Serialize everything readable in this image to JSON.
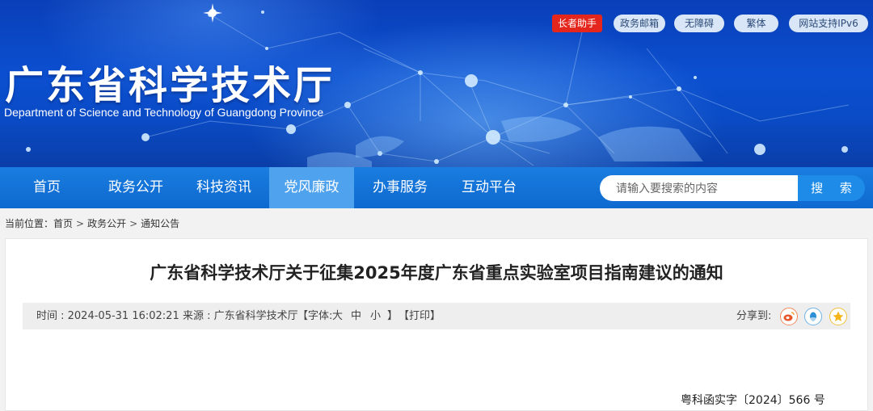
{
  "header": {
    "site_title": "广东省科学技术厅",
    "site_subtitle": "Department of Science and Technology of Guangdong Province",
    "top_links": [
      "长者助手",
      "政务邮箱",
      "无障碍",
      "繁体",
      "网站支持IPv6"
    ]
  },
  "nav": {
    "items": [
      "首页",
      "政务公开",
      "科技资讯",
      "党风廉政",
      "办事服务",
      "互动平台"
    ],
    "active": "党风廉政",
    "search_placeholder": "请输入要搜索的内容",
    "search_button": "搜 索"
  },
  "breadcrumb": {
    "prefix": "当前位置：",
    "items": [
      "首页",
      "政务公开",
      "通知公告"
    ],
    "separator": ">"
  },
  "article": {
    "title": "广东省科学技术厅关于征集2025年度广东省重点实验室项目指南建议的通知",
    "meta": {
      "time": "时间 : 2024-05-31 16:02:21",
      "source": "来源 : 广东省科学技术厅",
      "font_label": "【字体:",
      "font_sizes": [
        "大",
        "中",
        "小"
      ],
      "font_close": "】",
      "print": "【打印】"
    },
    "share_label": "分享到:",
    "share_icons": [
      "weibo-icon",
      "qq-icon",
      "qzone-icon"
    ],
    "doc_number": "粤科函实字〔2024〕566 号"
  },
  "colors": {
    "nav_bg": "#0e69cf",
    "nav_active": "#4fa2ee",
    "elder_badge": "#e4261c",
    "pill_bg": "#d9e6f7"
  }
}
